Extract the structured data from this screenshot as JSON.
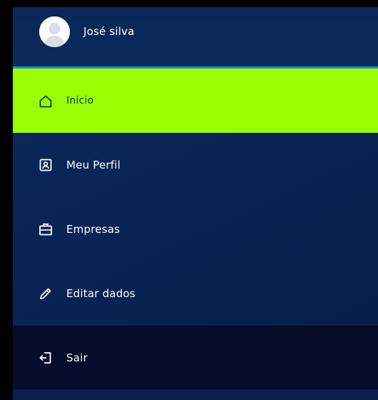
{
  "profile": {
    "name": "José silva",
    "avatar_icon": "user-avatar-icon"
  },
  "nav": {
    "items": [
      {
        "label": "Início",
        "icon": "home-icon",
        "active": true
      },
      {
        "label": "Meu Perfil",
        "icon": "profile-card-icon",
        "active": false
      },
      {
        "label": "Empresas",
        "icon": "briefcase-icon",
        "active": false
      },
      {
        "label": "Editar dados",
        "icon": "pencil-icon",
        "active": false
      }
    ],
    "logout": {
      "label": "Sair",
      "icon": "logout-icon"
    }
  },
  "colors": {
    "panel_background": "#0a2455",
    "active_background": "#99ff00",
    "active_text": "#15315f",
    "logout_background": "#050d2a",
    "divider": "#1d8fd0",
    "text": "#ffffff"
  }
}
